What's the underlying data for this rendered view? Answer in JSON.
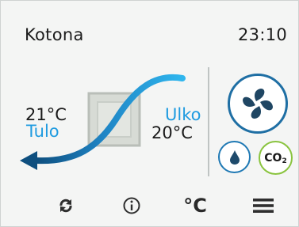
{
  "header": {
    "location_label": "Kotona",
    "time": "23:10"
  },
  "flow": {
    "supply_temperature": "21°C",
    "supply_label": "Tulo",
    "outdoor_label": "Ulko",
    "outdoor_temperature": "20°C"
  },
  "modes": {
    "fan_icon": "fan-icon",
    "humidity_icon": "water-drop-icon",
    "co2_text": "CO",
    "co2_subscript": "2"
  },
  "nav": {
    "refresh_icon": "refresh-icon",
    "info_icon": "info-icon",
    "unit_label": "°C",
    "menu_icon": "menu-icon"
  },
  "colors": {
    "accent_blue": "#1f9be0",
    "fan_ring": "#1f6fa4",
    "co2_ring": "#8ac43f",
    "heat_exchanger": "#c9cec8"
  }
}
